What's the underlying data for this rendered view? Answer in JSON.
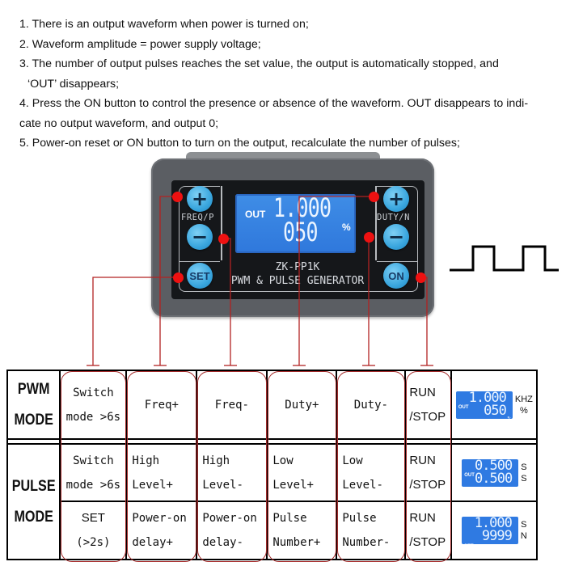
{
  "notes": [
    "1. There is an output waveform when power is turned on;",
    "2. Waveform amplitude = power supply voltage;",
    "3. The number of output pulses reaches the set value, the output is automatically stopped, and",
    "‘OUT’   disappears;",
    "4. Press the ON button to control the presence or absence of the waveform. OUT disappears to indi-",
    "cate no output waveform, and output 0;",
    "5. Power-on reset or ON button to turn on the output, recalculate the number of pulses;"
  ],
  "device": {
    "model": "ZK-PP1K",
    "subtitle": "PWM & PULSE GENERATOR",
    "freq_label": "FREQ/P",
    "duty_label": "DUTY/N",
    "set_label": "SET",
    "on_label": "ON",
    "plus_symbol": "+",
    "minus_symbol": "−",
    "lcd": {
      "out": "OUT",
      "line1": "1.000",
      "line2": "050",
      "unit": "%"
    },
    "accent_color": "#3aa6de",
    "marker_color": "#ee1111"
  },
  "waveform": {
    "icon": "square-wave-icon"
  },
  "table": {
    "pwm": {
      "mode_line1": "PWM",
      "mode_line2": "MODE",
      "cells": [
        [
          "Switch",
          "mode >6s"
        ],
        [
          "Freq+"
        ],
        [
          "Freq-"
        ],
        [
          "Duty+"
        ],
        [
          "Duty-"
        ],
        [
          "RUN",
          "/STOP"
        ]
      ],
      "lcd": {
        "tag1": "OUT",
        "r1": "1.000",
        "r2": "050",
        "pct": "%",
        "tag2": ""
      },
      "units": [
        "KHZ",
        "%"
      ]
    },
    "pulse": {
      "mode_line1": "PULSE",
      "mode_line2": "MODE",
      "row1": [
        [
          "Switch",
          "mode >6s"
        ],
        [
          "High",
          "Level+"
        ],
        [
          "High",
          "Level-"
        ],
        [
          "Low",
          "Level+"
        ],
        [
          "Low",
          "Level-"
        ],
        [
          "RUN",
          "/STOP"
        ]
      ],
      "row1_lcd": {
        "tag1": "OUT",
        "r1": "0.500",
        "r2": "0.500",
        "tag2": ""
      },
      "row1_units": [
        "S",
        "S"
      ],
      "row2": [
        [
          "SET",
          "(>2s)"
        ],
        [
          "Power-on",
          "delay+"
        ],
        [
          "Power-on",
          "delay-"
        ],
        [
          "Pulse",
          "Number+"
        ],
        [
          "Pulse",
          "Number-"
        ],
        [
          "RUN",
          "/STOP"
        ]
      ],
      "row2_lcd": {
        "tag1": "",
        "r1": "1.000",
        "r2": "9999",
        "tag2": "SET"
      },
      "row2_units": [
        "S",
        "N"
      ]
    }
  }
}
